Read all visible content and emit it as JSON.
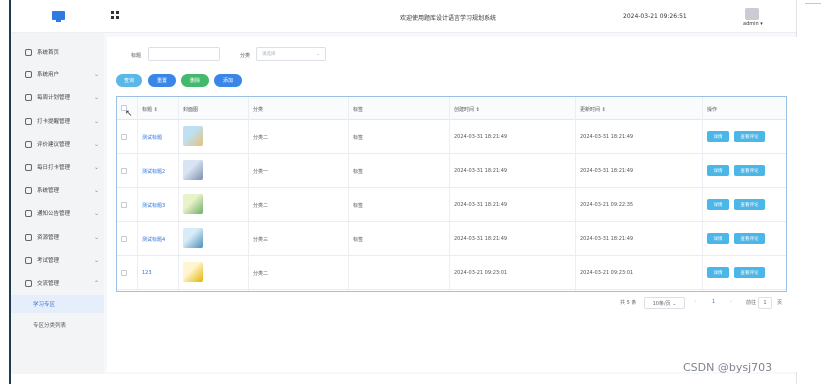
{
  "header": {
    "site_title": "欢迎使用题库设计语言学习规划系统",
    "datetime": "2024-03-21 09:26:51",
    "user": "admin ▾"
  },
  "sidebar": {
    "items": [
      {
        "label": "系统首页",
        "icon": "clock-icon",
        "chevron": ""
      },
      {
        "label": "系统用户",
        "icon": "user-icon",
        "chevron": "⌄"
      },
      {
        "label": "每周计划管理",
        "icon": "calendar-icon",
        "chevron": "⌄"
      },
      {
        "label": "打卡提醒管理",
        "icon": "calendar-icon",
        "chevron": "⌄"
      },
      {
        "label": "评价建议管理",
        "icon": "calendar-icon",
        "chevron": "⌄"
      },
      {
        "label": "每日打卡管理",
        "icon": "calendar-icon",
        "chevron": "⌄"
      },
      {
        "label": "系统管理",
        "icon": "folder-icon",
        "chevron": "⌄"
      },
      {
        "label": "通知公告管理",
        "icon": "search-icon",
        "chevron": "⌄"
      },
      {
        "label": "资源管理",
        "icon": "box-icon",
        "chevron": "⌄"
      },
      {
        "label": "考试管理",
        "icon": "timer-icon",
        "chevron": "⌄"
      },
      {
        "label": "交流管理",
        "icon": "headset-icon",
        "chevron": "⌃"
      }
    ],
    "submenu": [
      {
        "label": "学习专区",
        "active": true
      },
      {
        "label": "专区分类列表",
        "active": false
      }
    ]
  },
  "filter": {
    "title_label": "标题",
    "title_value": "",
    "category_label": "分类",
    "category_placeholder": "请选择",
    "category_chevron": "⌄"
  },
  "toolbar": {
    "query": "查询",
    "reset": "重置",
    "delete": "删除",
    "add": "添加"
  },
  "table": {
    "headers": {
      "title": "标题 ⇕",
      "cover": "封面图",
      "category": "分类",
      "tag": "标签",
      "created": "创建时间 ⇕",
      "updated": "更新时间 ⇕",
      "actions": "操作"
    },
    "rows": [
      {
        "title": "测试标题",
        "category": "分类二",
        "tag": "标签",
        "created": "2024-03-31 18:21:49",
        "updated": "2024-03-31 18:21:49",
        "btn1": "详情",
        "btn2": "查看评论"
      },
      {
        "title": "测试标题2",
        "category": "分类一",
        "tag": "标签",
        "created": "2024-03-31 18:21:49",
        "updated": "2024-03-31 18:21:49",
        "btn1": "详情",
        "btn2": "查看评论"
      },
      {
        "title": "测试标题3",
        "category": "分类二",
        "tag": "标签",
        "created": "2024-03-31 18:21:49",
        "updated": "2024-03-21 09:22:35",
        "btn1": "详情",
        "btn2": "查看评论"
      },
      {
        "title": "测试标题4",
        "category": "分类三",
        "tag": "标签",
        "created": "2024-03-31 18:21:49",
        "updated": "2024-03-31 18:21:49",
        "btn1": "详情",
        "btn2": "查看评论"
      },
      {
        "title": "123",
        "category": "分类二",
        "tag": "",
        "created": "2024-03-21 09:23:01",
        "updated": "2024-03-21 09:23:01",
        "btn1": "详情",
        "btn2": "查看评论"
      }
    ]
  },
  "pagination": {
    "total": "共 5 条",
    "page_size": "10条/页 ⌄",
    "prev": "‹",
    "current": "1",
    "next": "›",
    "goto_label": "前往",
    "goto_value": "1",
    "page_suffix": "页"
  },
  "watermark": "CSDN @bysj703",
  "colors": {
    "query": "#59b8e8",
    "reset": "#3a86e8",
    "delete": "#43b96e",
    "add": "#3a86e8",
    "link": "#2f73d8",
    "sidebar_active": "#e7eefb"
  }
}
